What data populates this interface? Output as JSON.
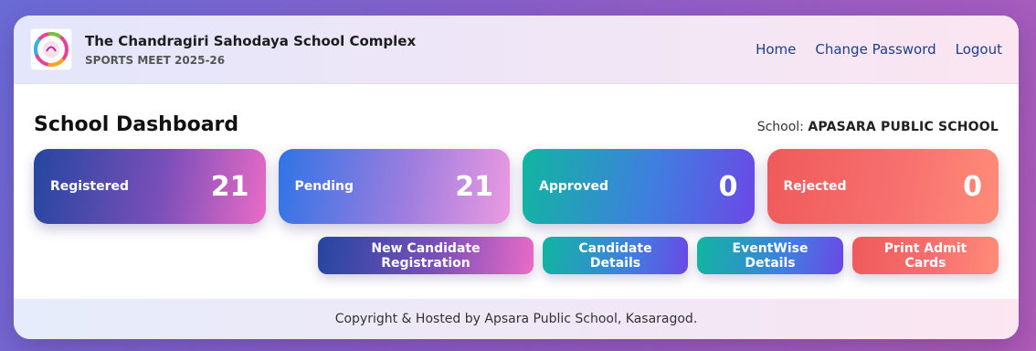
{
  "header": {
    "title": "The Chandragiri Sahodaya School Complex",
    "subtitle": "SPORTS MEET 2025-26",
    "logo_icon": "school-logo-icon",
    "nav": [
      {
        "label": "Home"
      },
      {
        "label": "Change Password"
      },
      {
        "label": "Logout"
      }
    ]
  },
  "main": {
    "page_title": "School Dashboard",
    "school_prefix": "School:",
    "school_name": "APASARA PUBLIC SCHOOL",
    "stats": [
      {
        "label": "Registered",
        "value": "21"
      },
      {
        "label": "Pending",
        "value": "21"
      },
      {
        "label": "Approved",
        "value": "0"
      },
      {
        "label": "Rejected",
        "value": "0"
      }
    ],
    "actions": [
      {
        "label": "New Candidate Registration"
      },
      {
        "label": "Candidate Details"
      },
      {
        "label": "EventWise Details"
      },
      {
        "label": "Print Admit Cards"
      }
    ]
  },
  "footer": {
    "text": "Copyright & Hosted by Apsara Public School, Kasaragod."
  },
  "colors": {
    "nav_link": "#1e3d8f",
    "stat_registered": "#2446a0",
    "stat_pending": "#2f74e6",
    "stat_approved": "#10b6a0",
    "stat_rejected": "#ef5a5a"
  }
}
